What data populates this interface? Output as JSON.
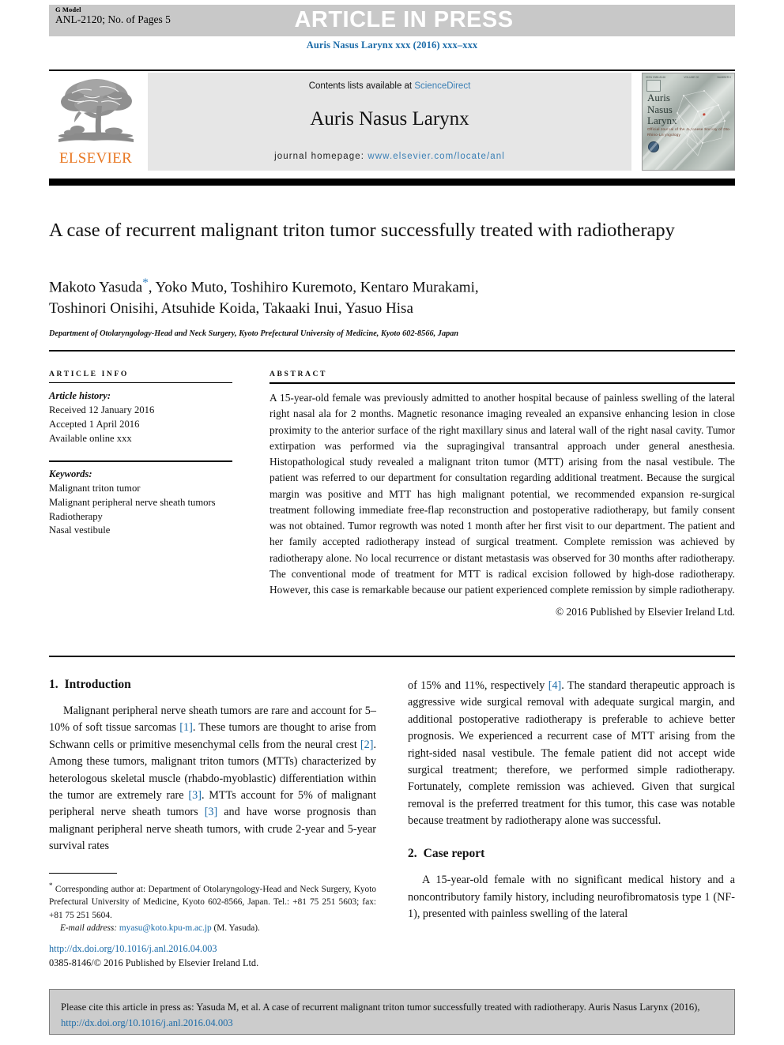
{
  "header": {
    "g_model_label": "G Model",
    "article_id": "ANL-2120; No. of Pages 5",
    "article_in_press": "ARTICLE IN PRESS",
    "journal_reference": "Auris Nasus Larynx xxx (2016) xxx–xxx"
  },
  "banner": {
    "contents_prefix": "Contents lists available at ",
    "sciencedirect": "ScienceDirect",
    "journal_title": "Auris Nasus Larynx",
    "homepage_label": "journal homepage: ",
    "homepage_url": "www.elsevier.com/locate/anl",
    "publisher_wordmark": "ELSEVIER",
    "cover": {
      "title_line1": "Auris",
      "title_line2": "Nasus",
      "title_line3": "Larynx",
      "subtitle": "Official Journal of the Japanese Society of Oto-Rhino-Laryngology"
    }
  },
  "article": {
    "title": "A case of recurrent malignant triton tumor successfully treated with radiotherapy",
    "authors_line1": "Makoto Yasuda",
    "authors_line1_rest": ", Yoko Muto, Toshihiro Kuremoto, Kentaro Murakami,",
    "authors_line2": "Toshinori Onisihi, Atsuhide Koida, Takaaki Inui, Yasuo Hisa",
    "corresponding_marker": "*",
    "affiliation": "Department of Otolaryngology-Head and Neck Surgery, Kyoto Prefectural University of Medicine, Kyoto 602-8566, Japan"
  },
  "article_info": {
    "heading": "ARTICLE INFO",
    "history_label": "Article history:",
    "received": "Received 12 January 2016",
    "accepted": "Accepted 1 April 2016",
    "available_online": "Available online xxx",
    "keywords_label": "Keywords:",
    "keywords": [
      "Malignant triton tumor",
      "Malignant peripheral nerve sheath tumors",
      "Radiotherapy",
      "Nasal vestibule"
    ]
  },
  "abstract": {
    "heading": "ABSTRACT",
    "body": "A 15-year-old female was previously admitted to another hospital because of painless swelling of the lateral right nasal ala for 2 months. Magnetic resonance imaging revealed an expansive enhancing lesion in close proximity to the anterior surface of the right maxillary sinus and lateral wall of the right nasal cavity. Tumor extirpation was performed via the supragingival transantral approach under general anesthesia. Histopathological study revealed a malignant triton tumor (MTT) arising from the nasal vestibule. The patient was referred to our department for consultation regarding additional treatment. Because the surgical margin was positive and MTT has high malignant potential, we recommended expansion re-surgical treatment following immediate free-flap reconstruction and postoperative radiotherapy, but family consent was not obtained. Tumor regrowth was noted 1 month after her first visit to our department. The patient and her family accepted radiotherapy instead of surgical treatment. Complete remission was achieved by radiotherapy alone. No local recurrence or distant metastasis was observed for 30 months after radiotherapy. The conventional mode of treatment for MTT is radical excision followed by high-dose radiotherapy. However, this case is remarkable because our patient experienced complete remission by simple radiotherapy.",
    "copyright": "© 2016 Published by Elsevier Ireland Ltd."
  },
  "sections": {
    "introduction": {
      "number": "1.",
      "title": "Introduction",
      "para_part1": "Malignant peripheral nerve sheath tumors are rare and account for 5–10% of soft tissue sarcomas ",
      "ref1": "[1]",
      "para_part2": ". These tumors are thought to arise from Schwann cells or primitive mesenchymal cells from the neural crest ",
      "ref2": "[2]",
      "para_part3": ". Among these tumors, malignant triton tumors (MTTs) characterized by heterologous skeletal muscle (rhabdo-myoblastic) differentiation within the tumor are extremely rare ",
      "ref3": "[3]",
      "para_part4": ". MTTs account for 5% of malignant peripheral nerve sheath tumors ",
      "ref4": "[3]",
      "para_part5": " and have worse prognosis than malignant peripheral nerve sheath tumors, with crude 2-year and 5-year survival rates",
      "cont_part1": "of 15% and 11%, respectively ",
      "cont_ref": "[4]",
      "cont_part2": ". The standard therapeutic approach is aggressive wide surgical removal with adequate surgical margin, and additional postoperative radiotherapy is preferable to achieve better prognosis. We experienced a recurrent case of MTT arising from the right-sided nasal vestibule. The female patient did not accept wide surgical treatment; therefore, we performed simple radiotherapy. Fortunately, complete remission was achieved. Given that surgical removal is the preferred treatment for this tumor, this case was notable because treatment by radiotherapy alone was successful."
    },
    "case_report": {
      "number": "2.",
      "title": "Case report",
      "para": "A 15-year-old female with no significant medical history and a noncontributory family history, including neurofibromatosis type 1 (NF-1), presented with painless swelling of the lateral"
    }
  },
  "footnote": {
    "marker": "*",
    "corresponding": " Corresponding author at: Department of Otolaryngology-Head and Neck Surgery, Kyoto Prefectural University of Medicine, Kyoto 602-8566, Japan. Tel.: +81 75 251 5603; fax: +81 75 251 5604.",
    "email_label": "E-mail address:",
    "email": "myasu@koto.kpu-m.ac.jp",
    "email_owner": "(M. Yasuda).",
    "doi_url": "http://dx.doi.org/10.1016/j.anl.2016.04.003",
    "issn_line": "0385-8146/© 2016 Published by Elsevier Ireland Ltd."
  },
  "citation_box": {
    "text_part1": "Please cite this article in press as: Yasuda M, et al. A case of recurrent malignant triton tumor successfully treated with radiotherapy. Auris Nasus Larynx (2016), ",
    "link": "http://dx.doi.org/10.1016/j.anl.2016.04.003"
  },
  "colors": {
    "link_blue": "#1b6ba8",
    "elsevier_orange": "#e87722",
    "top_bar_gray": "#c8c8c8",
    "banner_gray": "#e6e6e6",
    "cite_box_gray": "#cccccc"
  }
}
